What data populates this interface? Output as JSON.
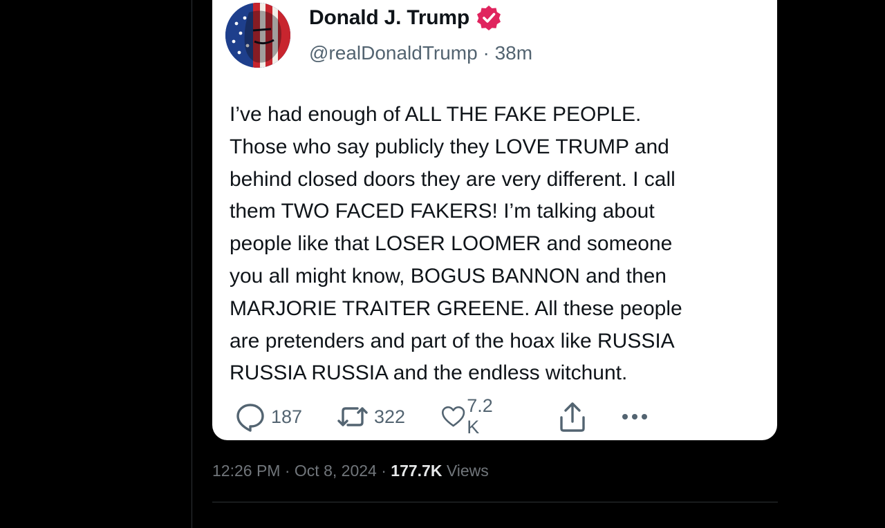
{
  "tweet": {
    "author_name": "Donald J. Trump",
    "handle": "@realDonaldTrump",
    "separator": "·",
    "time_ago": "38m",
    "text_lines": [
      "I’ve had enough of ALL THE FAKE PEOPLE.",
      "Those who say publicly they LOVE TRUMP and",
      "behind closed doors they are very different. I call",
      "them TWO FACED FAKERS! I’m talking about",
      "people like that LOSER LOOMER and someone",
      "you all might know, BOGUS BANNON and then",
      "MARJORIE TRAITER GREENE. All these people",
      "are pretenders and part of the hoax like RUSSIA",
      "RUSSIA RUSSIA and the endless witchunt."
    ],
    "replies": "187",
    "reposts": "322",
    "likes": "7.2 K",
    "icons": {
      "verified": "verified-badge-icon",
      "reply": "reply-icon",
      "repost": "repost-icon",
      "like": "heart-icon",
      "share": "share-icon",
      "more": "more-icon"
    },
    "colors": {
      "verified": "#e0245e",
      "text": "#0f1419",
      "muted": "#536471"
    }
  },
  "post_meta": {
    "time": "12:26 PM",
    "separator": "·",
    "date": "Oct 8, 2024",
    "views_count": "177.7K",
    "views_label": "Views"
  }
}
